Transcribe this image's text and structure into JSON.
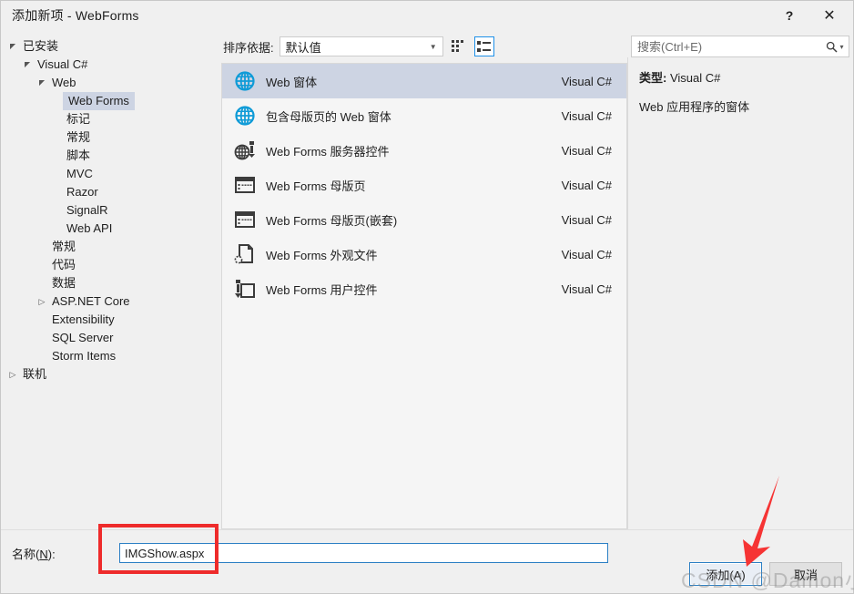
{
  "window": {
    "title": "添加新项 - WebForms",
    "help_label": "?",
    "close_label": "✕"
  },
  "sidebar": {
    "items": [
      {
        "label": "已安装",
        "indent": 0,
        "twisty": "expanded",
        "selected": false
      },
      {
        "label": "Visual C#",
        "indent": 1,
        "twisty": "expanded",
        "selected": false
      },
      {
        "label": "Web",
        "indent": 2,
        "twisty": "expanded",
        "selected": false
      },
      {
        "label": "Web Forms",
        "indent": 3,
        "twisty": "none",
        "selected": true
      },
      {
        "label": "标记",
        "indent": 3,
        "twisty": "none",
        "selected": false
      },
      {
        "label": "常规",
        "indent": 3,
        "twisty": "none",
        "selected": false
      },
      {
        "label": "脚本",
        "indent": 3,
        "twisty": "none",
        "selected": false
      },
      {
        "label": "MVC",
        "indent": 3,
        "twisty": "none",
        "selected": false
      },
      {
        "label": "Razor",
        "indent": 3,
        "twisty": "none",
        "selected": false
      },
      {
        "label": "SignalR",
        "indent": 3,
        "twisty": "none",
        "selected": false
      },
      {
        "label": "Web API",
        "indent": 3,
        "twisty": "none",
        "selected": false
      },
      {
        "label": "常规",
        "indent": 2,
        "twisty": "none",
        "selected": false
      },
      {
        "label": "代码",
        "indent": 2,
        "twisty": "none",
        "selected": false
      },
      {
        "label": "数据",
        "indent": 2,
        "twisty": "none",
        "selected": false
      },
      {
        "label": "ASP.NET Core",
        "indent": 2,
        "twisty": "collapsed",
        "selected": false
      },
      {
        "label": "Extensibility",
        "indent": 2,
        "twisty": "none",
        "selected": false
      },
      {
        "label": "SQL Server",
        "indent": 2,
        "twisty": "none",
        "selected": false
      },
      {
        "label": "Storm Items",
        "indent": 2,
        "twisty": "none",
        "selected": false
      },
      {
        "label": "联机",
        "indent": 0,
        "twisty": "collapsed",
        "selected": false
      }
    ]
  },
  "toolbar": {
    "sort_label": "排序依据:",
    "sort_value": "默认值",
    "grid_view_name": "grid-view-icon",
    "list_view_name": "list-view-icon"
  },
  "list": {
    "items": [
      {
        "name": "Web 窗体",
        "lang": "Visual C#",
        "icon": "globe-blue-icon",
        "selected": true
      },
      {
        "name": "包含母版页的 Web 窗体",
        "lang": "Visual C#",
        "icon": "globe-blue-icon",
        "selected": false
      },
      {
        "name": "Web Forms 服务器控件",
        "lang": "Visual C#",
        "icon": "globe-control-icon",
        "selected": false
      },
      {
        "name": "Web Forms 母版页",
        "lang": "Visual C#",
        "icon": "master-page-icon",
        "selected": false
      },
      {
        "name": "Web Forms 母版页(嵌套)",
        "lang": "Visual C#",
        "icon": "master-page-icon",
        "selected": false
      },
      {
        "name": "Web Forms 外观文件",
        "lang": "Visual C#",
        "icon": "skin-file-icon",
        "selected": false
      },
      {
        "name": "Web Forms 用户控件",
        "lang": "Visual C#",
        "icon": "user-control-icon",
        "selected": false
      }
    ]
  },
  "search": {
    "placeholder": "搜索(Ctrl+E)",
    "value": ""
  },
  "info": {
    "type_key": "类型:",
    "type_value": "Visual C#",
    "description": "Web 应用程序的窗体"
  },
  "footer": {
    "name_label_prefix": "名称(",
    "name_label_accel": "N",
    "name_label_suffix": "):",
    "name_value": "IMGShow.aspx",
    "add_label": "添加(A)",
    "cancel_label": "取消"
  },
  "annotations": {
    "watermark": "CSDN @Damon小智",
    "arrow_color": "#f63434",
    "rect_color": "#ee2b2b"
  },
  "colors": {
    "selection": "#cdd4e3",
    "accent": "#1e90e8",
    "focus_border": "#2b7fc4",
    "icon_blue": "#0f9bd7",
    "icon_dark": "#3c3c3c"
  }
}
